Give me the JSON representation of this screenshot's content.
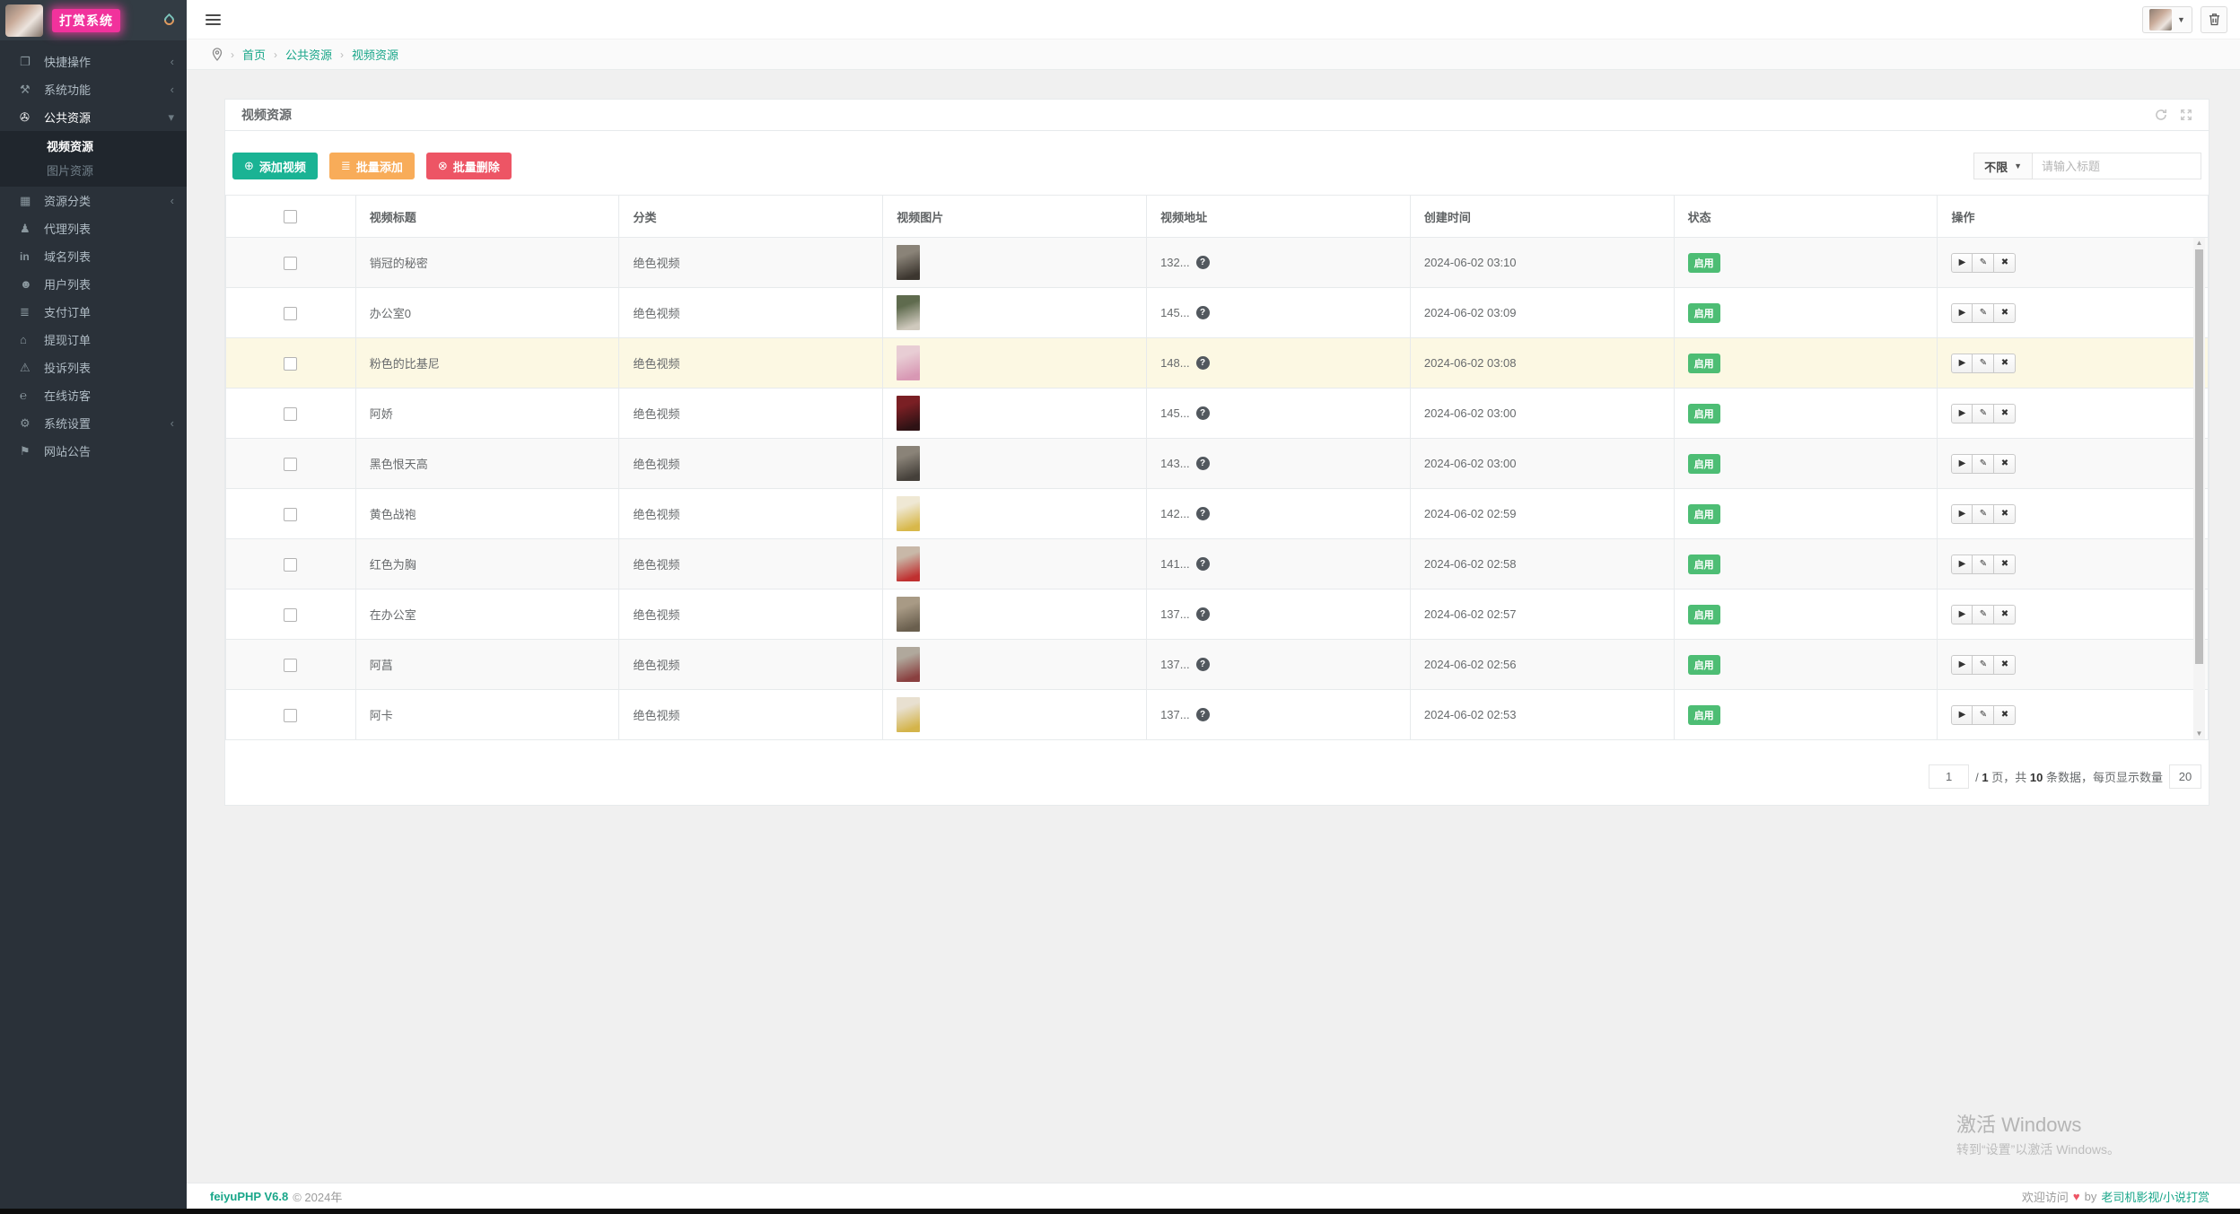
{
  "colors": {
    "accent_teal": "#1ab394",
    "link_teal": "#18a689",
    "warning_orange": "#f8ac59",
    "danger_red": "#ed5565",
    "status_green": "#4dbd74",
    "logo_pink": "#f1329c",
    "sidebar_bg": "#2a3139",
    "highlight_row": "#fcf8e3"
  },
  "logo": {
    "title": "打赏系统"
  },
  "sidebar": {
    "items": [
      {
        "id": "quick-actions",
        "icon": "folder-icon",
        "label": "快捷操作",
        "chevron": "left"
      },
      {
        "id": "system-functions",
        "icon": "wrench-icon",
        "label": "系统功能",
        "chevron": "left"
      },
      {
        "id": "public-resources",
        "icon": "video-camera-icon",
        "label": "公共资源",
        "chevron": "down",
        "active": true,
        "children": [
          {
            "label": "视频资源",
            "active": true
          },
          {
            "label": "图片资源"
          }
        ]
      },
      {
        "id": "resource-categories",
        "icon": "grid-icon",
        "label": "资源分类",
        "chevron": "left"
      },
      {
        "id": "agent-list",
        "icon": "users-icon",
        "label": "代理列表"
      },
      {
        "id": "domain-list",
        "icon": "linkedin-icon",
        "label": "域名列表"
      },
      {
        "id": "user-list",
        "icon": "user-icon",
        "label": "用户列表"
      },
      {
        "id": "payment-orders",
        "icon": "database-icon",
        "label": "支付订单"
      },
      {
        "id": "withdrawal-orders",
        "icon": "bank-icon",
        "label": "提现订单"
      },
      {
        "id": "complaint-list",
        "icon": "exclamation-icon",
        "label": "投诉列表"
      },
      {
        "id": "online-visitors",
        "icon": "edge-icon",
        "label": "在线访客"
      },
      {
        "id": "system-settings",
        "icon": "gear-icon",
        "label": "系统设置",
        "chevron": "left"
      },
      {
        "id": "site-announcements",
        "icon": "megaphone-icon",
        "label": "网站公告"
      }
    ]
  },
  "breadcrumb": {
    "items": [
      "首页",
      "公共资源",
      "视频资源"
    ]
  },
  "panel": {
    "title": "视频资源",
    "toolbar": {
      "add_label": "添加视频",
      "batch_add_label": "批量添加",
      "batch_delete_label": "批量删除",
      "filter_label": "不限",
      "search_placeholder": "请输入标题"
    },
    "table": {
      "headers": [
        "视频标题",
        "分类",
        "视频图片",
        "视频地址",
        "创建时间",
        "状态",
        "操作"
      ],
      "rows": [
        {
          "title": "销冠的秘密",
          "category": "绝色视频",
          "address": "132...",
          "created": "2024-06-02 03:10",
          "status": "启用",
          "highlight": false,
          "thumb_colors": [
            "#8a8378",
            "#3c362f"
          ]
        },
        {
          "title": "办公室0",
          "category": "绝色视频",
          "address": "145...",
          "created": "2024-06-02 03:09",
          "status": "启用",
          "highlight": false,
          "thumb_colors": [
            "#5f6b4e",
            "#cfc9bd"
          ]
        },
        {
          "title": "粉色的比基尼",
          "category": "绝色视频",
          "address": "148...",
          "created": "2024-06-02 03:08",
          "status": "启用",
          "highlight": true,
          "thumb_colors": [
            "#e8cdd4",
            "#d898b4"
          ]
        },
        {
          "title": "阿娇",
          "category": "绝色视频",
          "address": "145...",
          "created": "2024-06-02 03:00",
          "status": "启用",
          "highlight": false,
          "thumb_colors": [
            "#7a1f24",
            "#2e1214"
          ]
        },
        {
          "title": "黑色恨天高",
          "category": "绝色视频",
          "address": "143...",
          "created": "2024-06-02 03:00",
          "status": "启用",
          "highlight": false,
          "thumb_colors": [
            "#8a8378",
            "#45403a"
          ]
        },
        {
          "title": "黄色战袍",
          "category": "绝色视频",
          "address": "142...",
          "created": "2024-06-02 02:59",
          "status": "启用",
          "highlight": false,
          "thumb_colors": [
            "#efe8d4",
            "#d8b84a"
          ]
        },
        {
          "title": "红色为胸",
          "category": "绝色视频",
          "address": "141...",
          "created": "2024-06-02 02:58",
          "status": "启用",
          "highlight": false,
          "thumb_colors": [
            "#c8b8a8",
            "#c03030"
          ]
        },
        {
          "title": "在办公室",
          "category": "绝色视频",
          "address": "137...",
          "created": "2024-06-02 02:57",
          "status": "启用",
          "highlight": false,
          "thumb_colors": [
            "#a89a85",
            "#6a5f4e"
          ]
        },
        {
          "title": "阿菖",
          "category": "绝色视频",
          "address": "137...",
          "created": "2024-06-02 02:56",
          "status": "启用",
          "highlight": false,
          "thumb_colors": [
            "#b0a89c",
            "#8a4040"
          ]
        },
        {
          "title": "阿卡",
          "category": "绝色视频",
          "address": "137...",
          "created": "2024-06-02 02:53",
          "status": "启用",
          "highlight": false,
          "thumb_colors": [
            "#e8e0d0",
            "#d4b44a"
          ]
        }
      ]
    },
    "pagination": {
      "page": "1",
      "slash": "/",
      "total_pages": "1",
      "pages_label": "页，共",
      "total_records": "10",
      "records_label": "条数据，每页显示数量",
      "per_page": "20"
    }
  },
  "footer": {
    "brand": "feiyuPHP V6.8",
    "copyright": "© 2024年",
    "welcome": "欢迎访问",
    "by": "by",
    "link": "老司机影视/小说打赏"
  },
  "watermark": {
    "line1": "激活 Windows",
    "line2": "转到“设置”以激活 Windows。"
  }
}
